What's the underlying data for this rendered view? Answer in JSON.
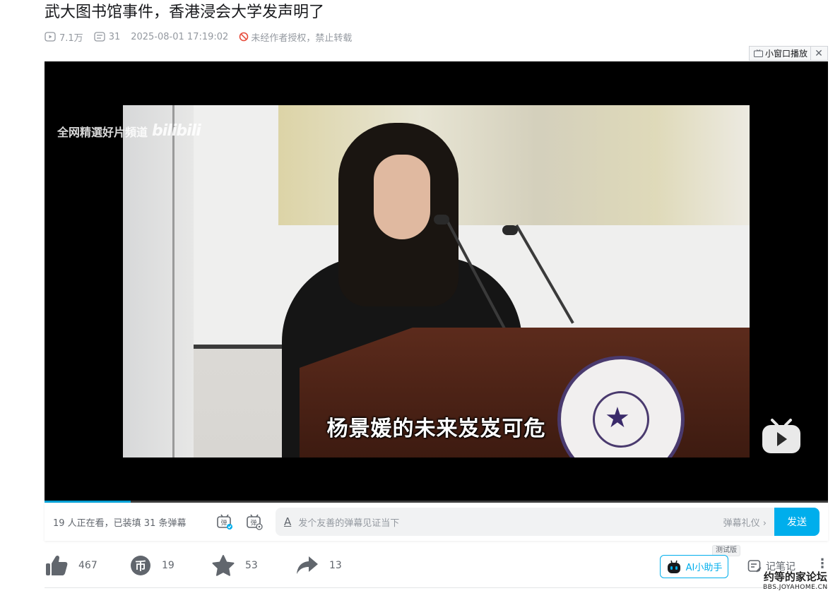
{
  "video": {
    "title": "武大图书馆事件，香港浸会大学发声明了",
    "views": "7.1万",
    "danmaku_count": "31",
    "pubdate": "2025-08-01 17:19:02",
    "copyright_notice": "未经作者授权，禁止转载"
  },
  "mini_player": {
    "label": "小窗口播放",
    "close": "✕"
  },
  "player": {
    "subtitle": "杨景媛的未来岌岌可危",
    "watermark_text": "全网精選好片頻道",
    "watermark_logo": "bilibili",
    "progress_fraction": 0.11
  },
  "danmaku_bar": {
    "watching": "19 人正在看，已装填 31 条弹幕",
    "input_icon": "A",
    "placeholder": "发个友善的弹幕见证当下",
    "etiquette": "弹幕礼仪 ›",
    "send": "发送"
  },
  "toolbar": {
    "like": "467",
    "coin": "19",
    "favorite": "53",
    "share": "13",
    "ai_assistant": "AI小助手",
    "beta": "测试版",
    "note": "记笔记",
    "more": "⋮"
  },
  "site_watermark": {
    "cn": "约等的家论坛",
    "en": "BBS.JOYAHOME.CN"
  },
  "colors": {
    "accent": "#00aeec",
    "muted": "#61666d",
    "light": "#9499a0",
    "danger": "#e74c3c"
  }
}
